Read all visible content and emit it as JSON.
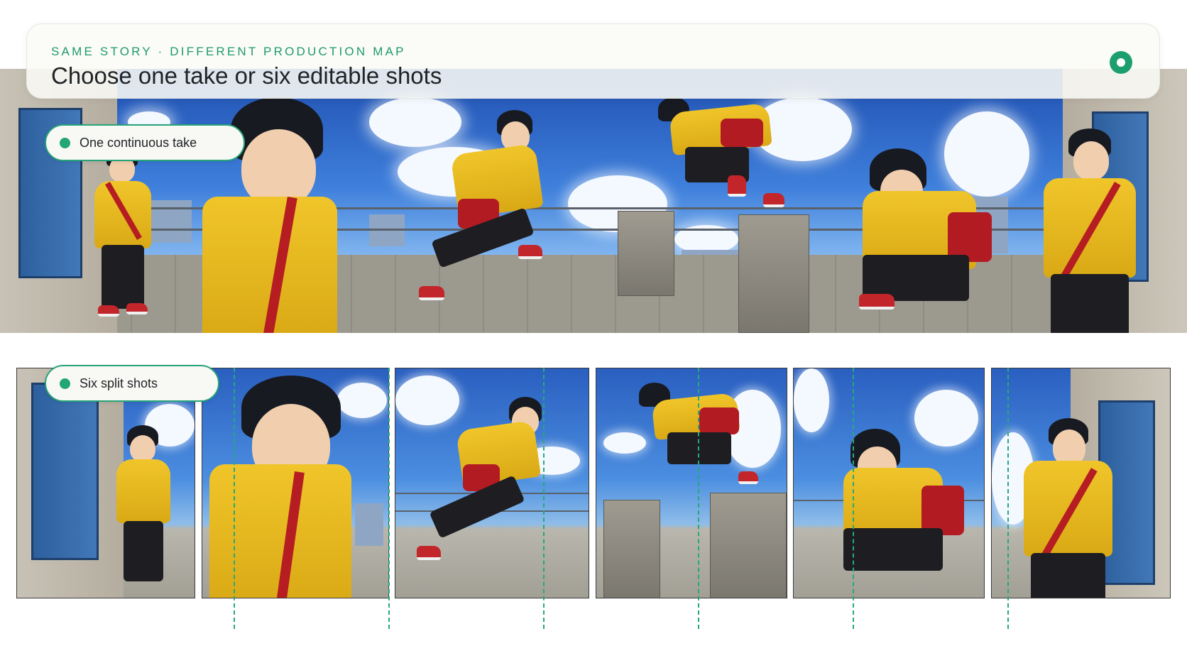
{
  "header": {
    "eyebrow": "SAME STORY · DIFFERENT PRODUCTION MAP",
    "title": "Choose one take or six editable shots"
  },
  "continuous": {
    "label": "One continuous take"
  },
  "split": {
    "label": "Six split shots",
    "shot_count": 6
  },
  "colors": {
    "accent": "#1e9a6e",
    "jacket": "#f0c52a",
    "bag": "#b51d22",
    "sky": "#3f80dc"
  }
}
